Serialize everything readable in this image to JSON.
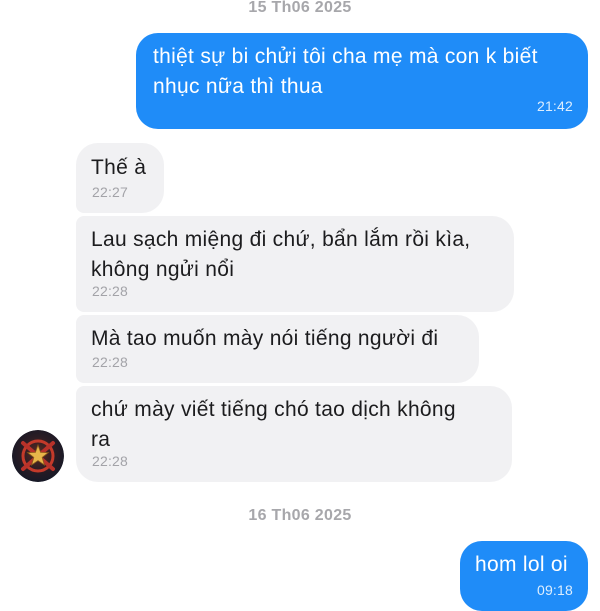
{
  "conversation": {
    "date_separators": [
      "15 Th06 2025",
      "16 Th06 2025"
    ],
    "messages": [
      {
        "direction": "outgoing",
        "text": "thiệt sự bi chửi tôi cha mẹ mà con k biết\nnhục nữa thì thua",
        "time": "21:42"
      },
      {
        "direction": "incoming",
        "text": "Thế à",
        "time": "22:27"
      },
      {
        "direction": "incoming",
        "text": "Lau sạch miệng đi chứ, bẩn lắm rồi kìa,\nkhông ngửi nổi",
        "time": "22:28"
      },
      {
        "direction": "incoming",
        "text": "Mà tao muốn mày nói tiếng người đi",
        "time": "22:28"
      },
      {
        "direction": "incoming",
        "text": "chứ mày viết tiếng chó tao dịch không\nra",
        "time": "22:28"
      },
      {
        "direction": "outgoing",
        "text": "hom lol oi",
        "time": "09:18"
      }
    ]
  },
  "colors": {
    "outgoing_bubble": "#1f8cf8",
    "incoming_bubble": "#f1f1f3",
    "date_text": "#a7a7ab"
  },
  "icons": {
    "avatar": "contact-avatar-icon"
  }
}
